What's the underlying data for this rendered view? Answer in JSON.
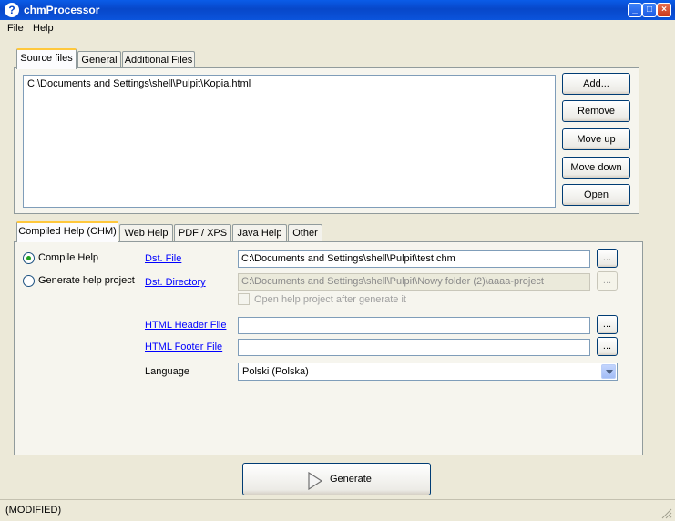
{
  "window": {
    "title": "chmProcessor",
    "icon_glyph": "?"
  },
  "menu": [
    "File",
    "Help"
  ],
  "top_tabs": [
    "Source files",
    "General",
    "Additional Files"
  ],
  "source_files": [
    "C:\\Documents and Settings\\shell\\Pulpit\\Kopia.html"
  ],
  "source_buttons": {
    "add": "Add...",
    "remove": "Remove",
    "move_up": "Move up",
    "move_down": "Move down",
    "open": "Open"
  },
  "bottom_tabs": [
    "Compiled Help (CHM)",
    "Web Help",
    "PDF / XPS",
    "Java Help",
    "Other"
  ],
  "chm": {
    "compile_help": "Compile Help",
    "generate_project": "Generate help project",
    "dst_file_label": "Dst. File",
    "dst_file_value": "C:\\Documents and Settings\\shell\\Pulpit\\test.chm",
    "dst_dir_label": "Dst. Directory",
    "dst_dir_value": "C:\\Documents and Settings\\shell\\Pulpit\\Nowy folder (2)\\aaaa-project",
    "open_after": "Open help project after generate it",
    "header_label": "HTML Header File",
    "header_value": "",
    "footer_label": "HTML Footer File",
    "footer_value": "",
    "language_label": "Language",
    "language_value": "Polski (Polska)",
    "browse": "..."
  },
  "generate_button": "Generate",
  "status": "(MODIFIED)",
  "colors": {
    "titlebar": "#0747c9",
    "tab_highlight": "#ffc83c",
    "link": "#0000ff"
  }
}
